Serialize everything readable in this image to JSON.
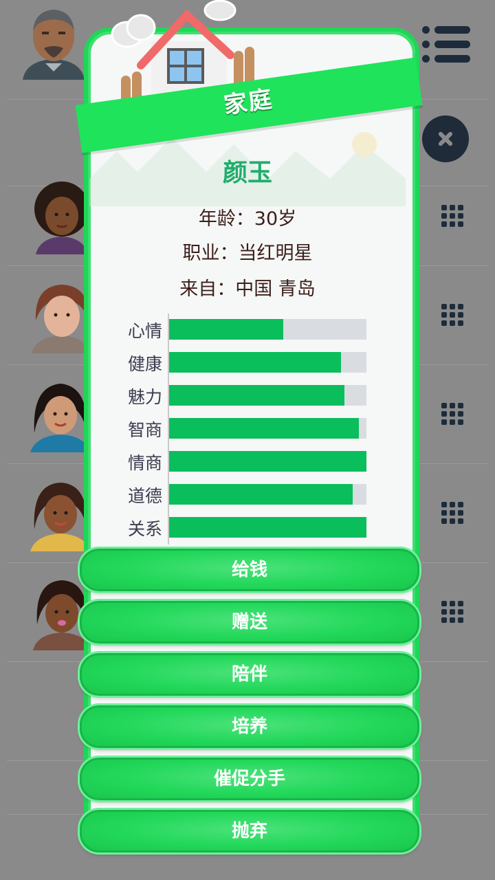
{
  "dialog": {
    "title": "家庭",
    "name": "颜玉",
    "age_line": "年龄：30岁",
    "job_line": "职业：当红明星",
    "origin_line": "来自：中国 青岛"
  },
  "stats": [
    {
      "label": "心情",
      "value": 0.58
    },
    {
      "label": "健康",
      "value": 0.87
    },
    {
      "label": "魅力",
      "value": 0.89
    },
    {
      "label": "智商",
      "value": 0.96
    },
    {
      "label": "情商",
      "value": 1.0
    },
    {
      "label": "道德",
      "value": 0.93
    },
    {
      "label": "关系",
      "value": 1.0
    }
  ],
  "actions": [
    {
      "label": "给钱"
    },
    {
      "label": "赠送"
    },
    {
      "label": "陪伴"
    },
    {
      "label": "培养"
    },
    {
      "label": "催促分手"
    },
    {
      "label": "抛弃"
    }
  ],
  "colors": {
    "accent": "#1fe35a",
    "bar_fill": "#0abe5c",
    "bar_track": "#d9dde1",
    "name": "#1eae6c",
    "overlay": "#8a8a8a"
  },
  "icons": [
    "menu-icon",
    "close-icon",
    "grid-icon",
    "house-icon"
  ]
}
